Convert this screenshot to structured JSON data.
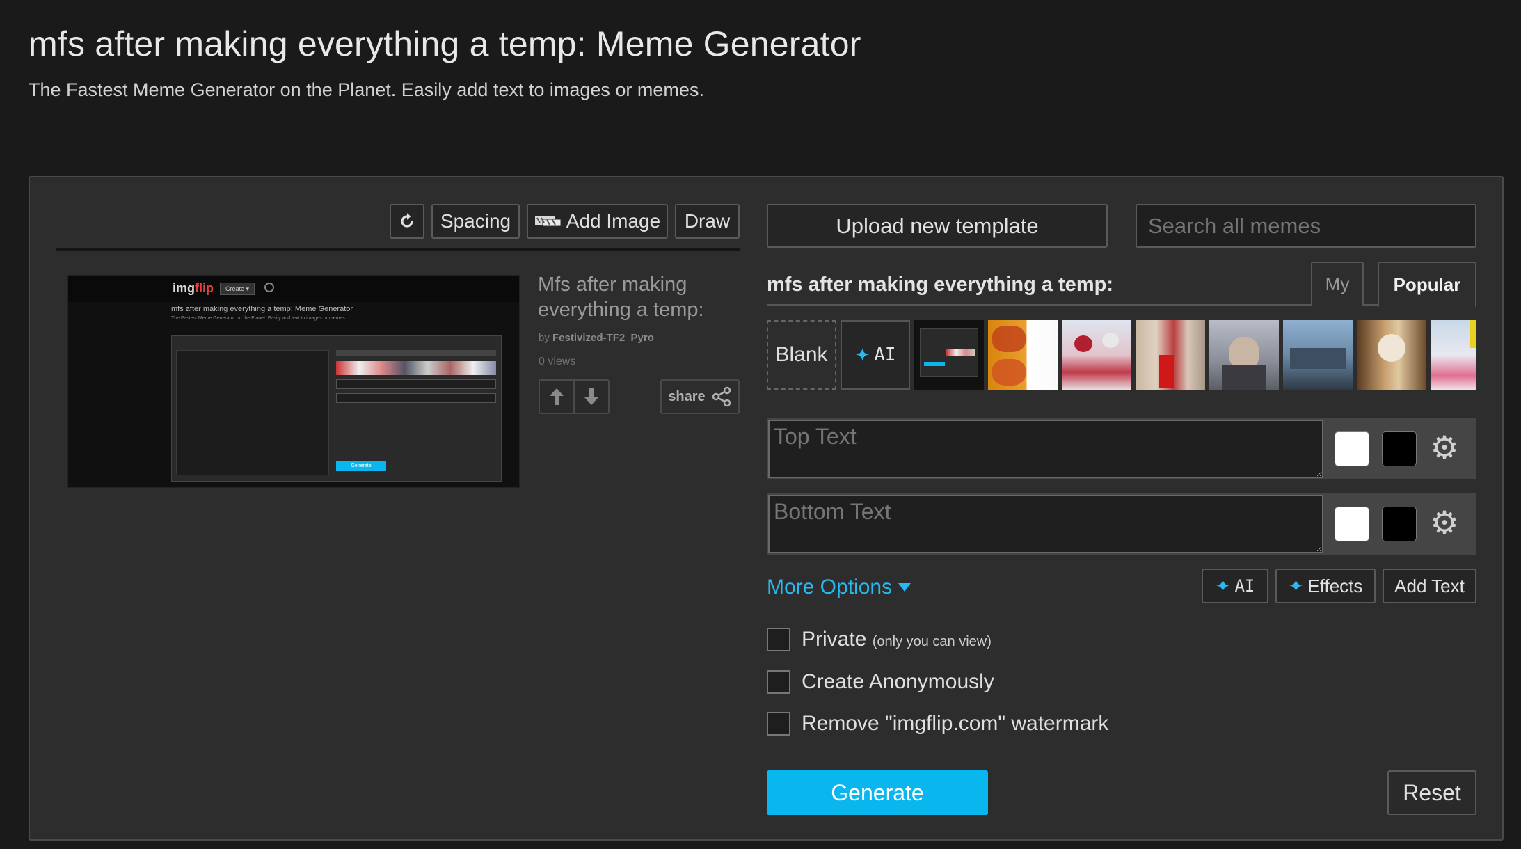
{
  "page": {
    "title": "mfs after making everything a temp: Meme Generator",
    "subtitle": "The Fastest Meme Generator on the Planet. Easily add text to images or memes."
  },
  "toolbar": {
    "refresh_icon": "refresh-icon",
    "spacing_label": "Spacing",
    "add_image_label": "Add Image",
    "draw_label": "Draw"
  },
  "preview": {
    "title": "Mfs after making everything a temp:",
    "by_prefix": "by",
    "author": "Festivized-TF2_Pyro",
    "views": "0 views",
    "share_label": "share",
    "shot": {
      "logo_img": "img",
      "logo_flip": "flip",
      "create": "Create ▾",
      "title": "mfs after making everything a temp: Meme Generator",
      "subtitle": "The Fastest Meme Generator on the Planet. Easily add text to images or memes.",
      "generate": "Generate"
    }
  },
  "controls": {
    "upload_label": "Upload new template",
    "search_placeholder": "Search all memes",
    "template_name": "mfs after making everything a temp:",
    "tabs": [
      {
        "label": "My",
        "active": false
      },
      {
        "label": "Popular",
        "active": true
      }
    ],
    "blank_label": "Blank",
    "ai_label": "AI",
    "top_text_placeholder": "Top Text",
    "bottom_text_placeholder": "Bottom Text",
    "more_options_label": "More Options",
    "ai_button_label": "AI",
    "effects_label": "Effects",
    "add_text_label": "Add Text",
    "options": [
      {
        "label": "Private",
        "note": "(only you can view)"
      },
      {
        "label": "Create Anonymously",
        "note": ""
      },
      {
        "label": "Remove \"imgflip.com\" watermark",
        "note": ""
      }
    ],
    "generate_label": "Generate",
    "reset_label": "Reset"
  },
  "colors": {
    "accent": "#0ab6ee",
    "link": "#2ab8f0",
    "background": "#1a1a1a",
    "panel": "#2d2d2d"
  }
}
